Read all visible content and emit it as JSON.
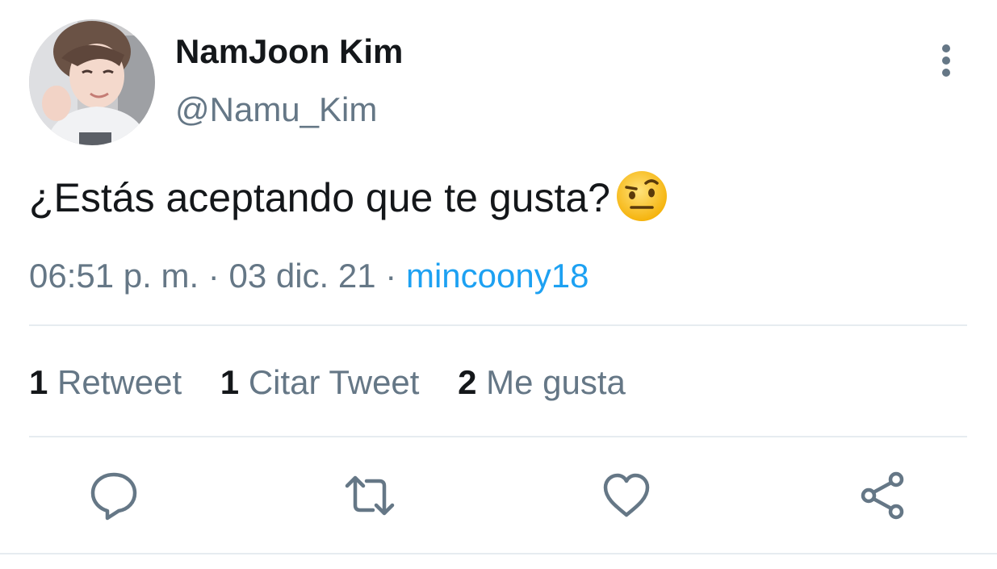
{
  "tweet": {
    "author": {
      "display_name": "NamJoon Kim",
      "handle": "@Namu_Kim",
      "avatar": "profile-photo"
    },
    "text": "¿Estás aceptando que te gusta?",
    "emoji": "face-with-raised-eyebrow",
    "time": "06:51 p. m.",
    "date": "03 dic. 21",
    "separator": "·",
    "via": "mincoony18",
    "stats": [
      {
        "count": "1",
        "label": "Retweet"
      },
      {
        "count": "1",
        "label": "Citar Tweet"
      },
      {
        "count": "2",
        "label": "Me gusta"
      }
    ]
  },
  "actions": [
    {
      "icon": "reply-icon"
    },
    {
      "icon": "retweet-icon"
    },
    {
      "icon": "like-icon"
    },
    {
      "icon": "share-icon"
    }
  ],
  "colors": {
    "text_primary": "#14171a",
    "text_secondary": "#657786",
    "link": "#1da1f2",
    "divider": "#e6ecf0"
  }
}
